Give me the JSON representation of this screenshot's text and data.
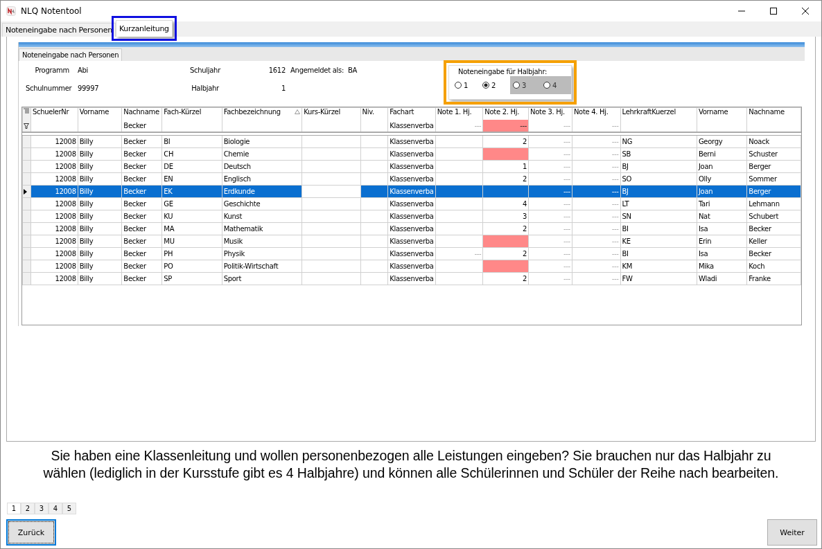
{
  "window": {
    "title": "NLQ Notentool"
  },
  "tabs": [
    {
      "label": "Noteneingabe nach Personen",
      "selected": false
    },
    {
      "label": "Kurzanleitung",
      "selected": true,
      "highlighted": true
    }
  ],
  "screenshot": {
    "tab": {
      "label": "Noteneingabe nach Personen",
      "selected": true
    },
    "info": [
      {
        "label": "Programm",
        "value": "Abi"
      },
      {
        "label": "Schuljahr",
        "value": "1612"
      },
      {
        "label": "Angemeldet als:",
        "value": "BA"
      },
      {
        "label": "Schulnummer",
        "value": "99997"
      },
      {
        "label": "Halbjahr",
        "value": "1"
      }
    ],
    "halbjahr": {
      "title": "Noteneingabe für Halbjahr:",
      "highlighted": true,
      "options": [
        {
          "label": "1",
          "selected": false,
          "disabled": false
        },
        {
          "label": "2",
          "selected": true,
          "disabled": false
        },
        {
          "label": "3",
          "selected": false,
          "disabled": true
        },
        {
          "label": "4",
          "selected": false,
          "disabled": true
        }
      ]
    },
    "table": {
      "columns": [
        {
          "label": "SchuelerNr",
          "sorted": false
        },
        {
          "label": "Vorname",
          "sorted": false
        },
        {
          "label": "Nachname",
          "sorted": false
        },
        {
          "label": "Fach-Kürzel",
          "sorted": false
        },
        {
          "label": "Fachbezeichnung",
          "sorted": true
        },
        {
          "label": "Kurs-Kürzel",
          "sorted": false
        },
        {
          "label": "Niv.",
          "sorted": false
        },
        {
          "label": "Fachart",
          "sorted": false
        },
        {
          "label": "Note 1. Hj.",
          "sorted": false
        },
        {
          "label": "Note 2. Hj.",
          "sorted": false
        },
        {
          "label": "Note 3. Hj.",
          "sorted": false
        },
        {
          "label": "Note 4. Hj.",
          "sorted": false
        },
        {
          "label": "LehrkraftKuerzel",
          "sorted": false
        },
        {
          "label": "Vorname",
          "sorted": false
        },
        {
          "label": "Nachname",
          "sorted": false
        }
      ],
      "filter": {
        "cells": [
          "",
          "",
          "Becker",
          "",
          "",
          "",
          "",
          "Klassenverba",
          "---",
          "---",
          "---",
          "---",
          "",
          "",
          ""
        ],
        "missing": true
      },
      "rows": [
        {
          "cells": [
            "12008",
            "Billy",
            "Becker",
            "BI",
            "Biologie",
            "",
            "",
            "Klassenverba",
            "",
            "2",
            "---",
            "---",
            "NG",
            "Georgy",
            "Noack"
          ],
          "selected": false,
          "missing": false
        },
        {
          "cells": [
            "12008",
            "Billy",
            "Becker",
            "CH",
            "Chemie",
            "",
            "",
            "Klassenverba",
            "",
            "",
            "---",
            "---",
            "SB",
            "Berni",
            "Schuster"
          ],
          "selected": false,
          "missing": true
        },
        {
          "cells": [
            "12008",
            "Billy",
            "Becker",
            "DE",
            "Deutsch",
            "",
            "",
            "Klassenverba",
            "",
            "1",
            "---",
            "---",
            "BJ",
            "Joan",
            "Berger"
          ],
          "selected": false,
          "missing": false
        },
        {
          "cells": [
            "12008",
            "Billy",
            "Becker",
            "EN",
            "Englisch",
            "",
            "",
            "Klassenverba",
            "",
            "2",
            "---",
            "---",
            "SO",
            "Olly",
            "Sommer"
          ],
          "selected": false,
          "missing": false
        },
        {
          "cells": [
            "12008",
            "Billy",
            "Becker",
            "EK",
            "Erdkunde",
            "",
            "",
            "Klassenverba",
            "",
            "",
            "---",
            "---",
            "BJ",
            "Joan",
            "Berger"
          ],
          "selected": true,
          "missing": false
        },
        {
          "cells": [
            "12008",
            "Billy",
            "Becker",
            "GE",
            "Geschichte",
            "",
            "",
            "Klassenverba",
            "",
            "4",
            "---",
            "---",
            "LT",
            "Tari",
            "Lehmann"
          ],
          "selected": false,
          "missing": false
        },
        {
          "cells": [
            "12008",
            "Billy",
            "Becker",
            "KU",
            "Kunst",
            "",
            "",
            "Klassenverba",
            "",
            "3",
            "---",
            "---",
            "SN",
            "Nat",
            "Schubert"
          ],
          "selected": false,
          "missing": false
        },
        {
          "cells": [
            "12008",
            "Billy",
            "Becker",
            "MA",
            "Mathematik",
            "",
            "",
            "Klassenverba",
            "",
            "2",
            "---",
            "---",
            "BI",
            "Isa",
            "Becker"
          ],
          "selected": false,
          "missing": false
        },
        {
          "cells": [
            "12008",
            "Billy",
            "Becker",
            "MU",
            "Musik",
            "",
            "",
            "Klassenverba",
            "",
            "",
            "---",
            "---",
            "KE",
            "Erin",
            "Keller"
          ],
          "selected": false,
          "missing": true
        },
        {
          "cells": [
            "12008",
            "Billy",
            "Becker",
            "PH",
            "Physik",
            "",
            "",
            "Klassenverba",
            "---",
            "2",
            "---",
            "---",
            "BI",
            "Isa",
            "Becker"
          ],
          "selected": false,
          "missing": false
        },
        {
          "cells": [
            "12008",
            "Billy",
            "Becker",
            "PO",
            "Politik-Wirtschaft",
            "",
            "",
            "Klassenverba",
            "",
            "",
            "---",
            "---",
            "KM",
            "Mika",
            "Koch"
          ],
          "selected": false,
          "missing": true
        },
        {
          "cells": [
            "12008",
            "Billy",
            "Becker",
            "SP",
            "Sport",
            "",
            "",
            "Klassenverba",
            "",
            "2",
            "---",
            "---",
            "FW",
            "Wladi",
            "Franke"
          ],
          "selected": false,
          "missing": false
        }
      ]
    }
  },
  "description": "Sie haben eine Klassenleitung und wollen personenbezogen alle Leistungen eingeben? Sie brauchen nur das Halbjahr zu wählen (lediglich in der Kursstufe gibt es 4 Halbjahre) und können alle Schülerinnen und Schüler der Reihe nach bearbeiten.",
  "pages": [
    {
      "label": "1",
      "selected": true
    },
    {
      "label": "2",
      "selected": false
    },
    {
      "label": "3",
      "selected": false
    },
    {
      "label": "4",
      "selected": false
    },
    {
      "label": "5",
      "selected": false
    }
  ],
  "buttons": {
    "back": {
      "label": "Zurück",
      "focused": true
    },
    "next": {
      "label": "Weiter",
      "focused": false
    }
  }
}
